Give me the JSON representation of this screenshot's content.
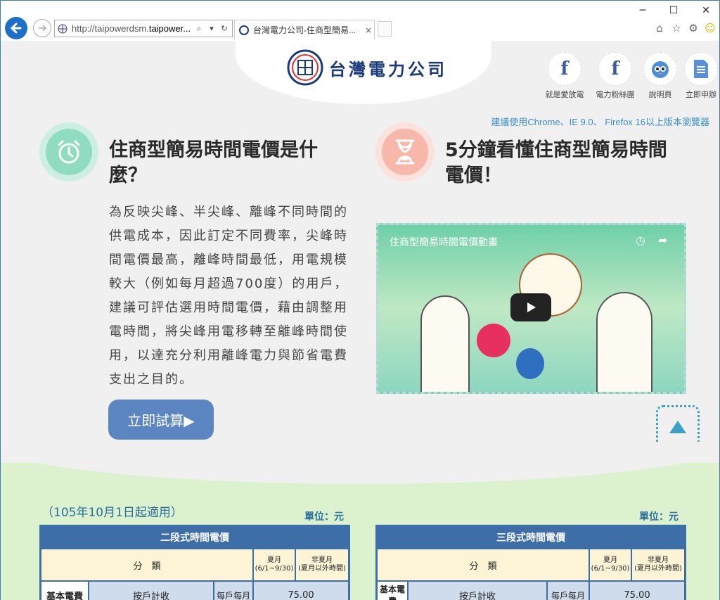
{
  "browser": {
    "url_prefix": "http://taipowerdsm.",
    "url_host": "taipower...",
    "tab_title": "台灣電力公司-住商型簡易...",
    "tab_close": "×"
  },
  "site": {
    "logo_text": "台灣電力公司"
  },
  "social": [
    {
      "label": "就是愛放電",
      "icon": "facebook-icon"
    },
    {
      "label": "電力粉絲團",
      "icon": "facebook-icon"
    },
    {
      "label": "說明頁",
      "icon": "mascot-icon"
    },
    {
      "label": "立即申辦",
      "icon": "document-icon"
    }
  ],
  "browser_note": "建議使用Chrome、IE 9.0、 Firefox 16以上版本瀏覽器",
  "section1": {
    "heading": "住商型簡易時間電價是什麼？",
    "body": "為反映尖峰、半尖峰、離峰不同時間的供電成本，因此訂定不同費率，尖峰時間電價最高，離峰時間最低，用電規模較大（例如每月超過700度）的用戶，建議可評估選用時間電價，藉由調整用電時間，將尖峰用電移轉至離峰時間使用，以達充分利用離峰電力與節省電費支出之目的。",
    "button": "立即試算▶"
  },
  "section2": {
    "heading": "5分鐘看懂住商型簡易時間電價！",
    "video_title": "住商型簡易時間電價動畫"
  },
  "rates": {
    "effective_date": "（105年10月1日起適用）",
    "unit": "單位：元",
    "tables": [
      {
        "title": "二段式時間電價",
        "category": "分　類",
        "summer": "夏月",
        "summer_range": "(6/1~9/30)",
        "nonsummer": "非夏月",
        "nonsummer_range": "(夏月以外時間)",
        "row_label": "基本電費",
        "row_sub": "按戶計收",
        "row_period": "每戶每月",
        "row_value": "75.00"
      },
      {
        "title": "三段式時間電價",
        "category": "分　類",
        "summer": "夏月",
        "summer_range": "(6/1~9/30)",
        "nonsummer": "非夏月",
        "nonsummer_range": "(夏月以外時間)",
        "row_label": "基本電費",
        "row_sub": "按戶計收",
        "row_period": "每戶每月",
        "row_value": "75.00"
      }
    ]
  }
}
